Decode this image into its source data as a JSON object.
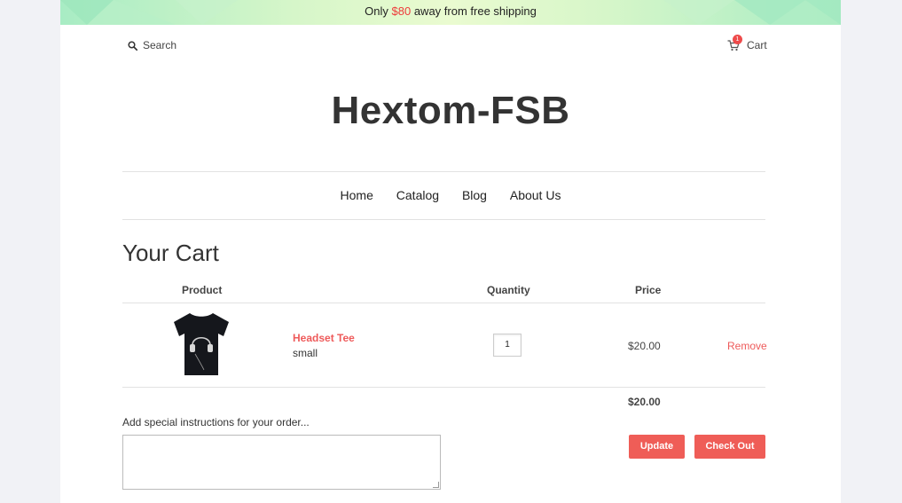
{
  "banner": {
    "prefix": "Only",
    "amount": "$80",
    "suffix": "away from free shipping"
  },
  "header": {
    "search_label": "Search",
    "cart_label": "Cart",
    "cart_count": "1"
  },
  "store": {
    "name": "Hextom-FSB"
  },
  "nav": {
    "items": [
      "Home",
      "Catalog",
      "Blog",
      "About Us"
    ]
  },
  "cart": {
    "title": "Your Cart",
    "columns": {
      "product": "Product",
      "quantity": "Quantity",
      "price": "Price"
    },
    "items": [
      {
        "name": "Headset Tee",
        "variant": "small",
        "quantity": "1",
        "price": "$20.00",
        "remove_label": "Remove"
      }
    ],
    "subtotal": "$20.00",
    "instructions_label": "Add special instructions for your order...",
    "instructions_value": "",
    "update_label": "Update",
    "checkout_label": "Check Out"
  },
  "colors": {
    "accent": "#ef5d57",
    "banner_amount": "#ee3b3b",
    "banner_bg": "#c9f2cf"
  }
}
